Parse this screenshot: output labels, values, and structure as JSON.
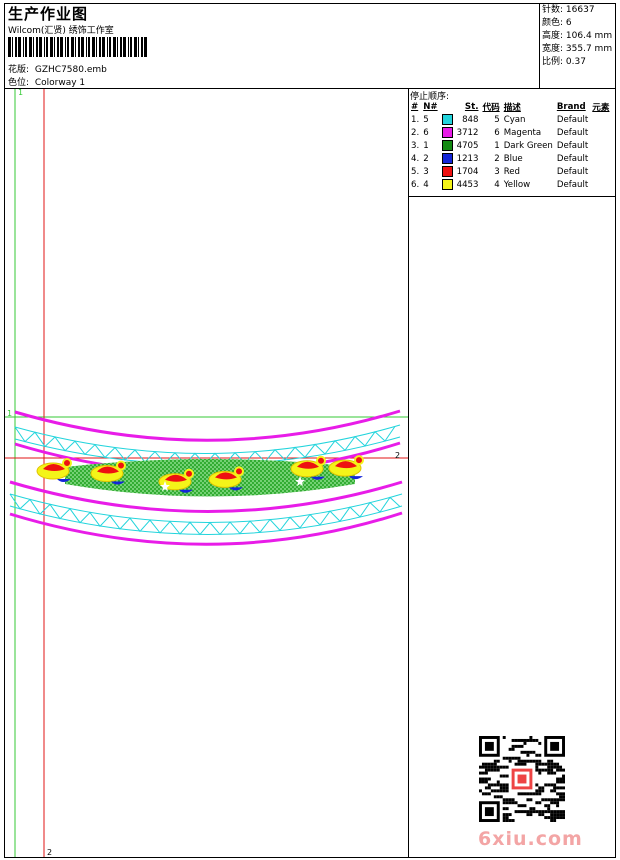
{
  "header": {
    "title": "生产作业图",
    "company": "Wilcom(汇贤) 绣饰工作室",
    "design_label": "花版:",
    "design_value": "GZHC7580.emb",
    "colorway_label": "色位:",
    "colorway_value": "Colorway 1"
  },
  "stats": [
    {
      "label": "针数:",
      "value": "16637"
    },
    {
      "label": "颜色:",
      "value": "6"
    },
    {
      "label": "高度:",
      "value": "106.4 mm"
    },
    {
      "label": "宽度:",
      "value": "355.7 mm"
    },
    {
      "label": "比例:",
      "value": "0.37"
    }
  ],
  "stop_sequence": {
    "title": "停止顺序:",
    "columns": [
      "#",
      "N#",
      "St.",
      "代码",
      "描述",
      "Brand",
      "元素"
    ],
    "rows": [
      {
        "idx": "1.",
        "n": "5",
        "swatch": "#22d4dc",
        "stitches": "848",
        "code": "5",
        "desc": "Cyan",
        "brand": "Default"
      },
      {
        "idx": "2.",
        "n": "6",
        "swatch": "#e81ce8",
        "stitches": "3712",
        "code": "6",
        "desc": "Magenta",
        "brand": "Default"
      },
      {
        "idx": "3.",
        "n": "1",
        "swatch": "#138a13",
        "stitches": "4705",
        "code": "1",
        "desc": "Dark Green",
        "brand": "Default"
      },
      {
        "idx": "4.",
        "n": "2",
        "swatch": "#1426d8",
        "stitches": "1213",
        "code": "2",
        "desc": "Blue",
        "brand": "Default"
      },
      {
        "idx": "5.",
        "n": "3",
        "swatch": "#ee1111",
        "stitches": "1704",
        "code": "3",
        "desc": "Red",
        "brand": "Default"
      },
      {
        "idx": "6.",
        "n": "4",
        "swatch": "#f4f419",
        "stitches": "4453",
        "code": "4",
        "desc": "Yellow",
        "brand": "Default"
      }
    ]
  },
  "guides": {
    "green_top": "1",
    "green_left": "1",
    "red_right": "2",
    "red_bottom": "2",
    "green_color": "#34c934",
    "red_color": "#e21616"
  },
  "watermark": {
    "text": "6xiu.com"
  }
}
